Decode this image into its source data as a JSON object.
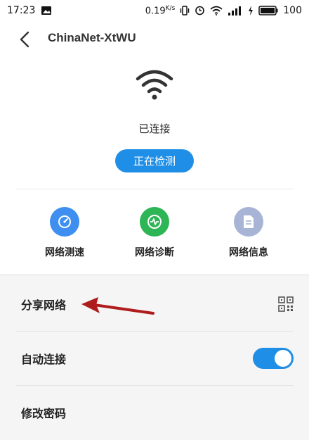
{
  "status_bar": {
    "time": "17:23",
    "net_speed": "0.19",
    "net_speed_unit": "K/s",
    "battery": "100",
    "icons": [
      "image-icon",
      "vibrate-icon",
      "alarm-icon",
      "wifi-icon",
      "signal-icon",
      "charging-icon",
      "battery-icon"
    ]
  },
  "header": {
    "title": "ChinaNet-XtWU"
  },
  "connection": {
    "status": "已连接",
    "detect_button": "正在检测"
  },
  "tools": [
    {
      "label": "网络测速",
      "icon": "speedometer-icon",
      "color": "#3f8ff0"
    },
    {
      "label": "网络诊断",
      "icon": "heartbeat-icon",
      "color": "#2db556"
    },
    {
      "label": "网络信息",
      "icon": "document-icon",
      "color": "#a8b4d6"
    }
  ],
  "settings": {
    "share_network": "分享网络",
    "auto_connect": "自动连接",
    "auto_connect_enabled": true,
    "change_password": "修改密码"
  },
  "colors": {
    "accent": "#1f8ee6",
    "annotation_arrow": "#b01c1c"
  }
}
